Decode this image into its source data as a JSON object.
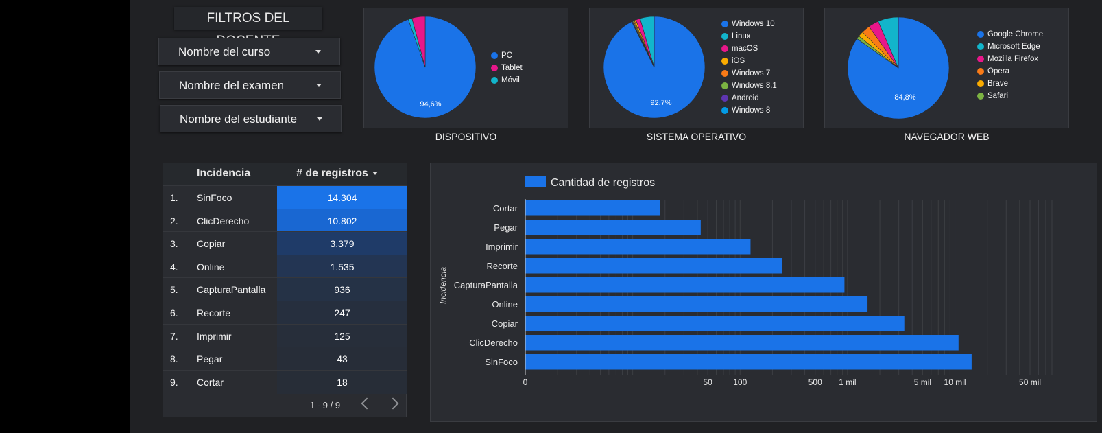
{
  "filters": {
    "title": "FILTROS DEL DOCENTE",
    "course": "Nombre del curso",
    "exam": "Nombre del examen",
    "student": "Nombre del estudiante"
  },
  "pies": [
    {
      "caption": "DISPOSITIVO",
      "center_label": "94,6%",
      "slices": [
        {
          "name": "PC",
          "value": 94.6,
          "color": "#1a73e8"
        },
        {
          "name": "Tablet",
          "value": 4.2,
          "color": "#e8178a"
        },
        {
          "name": "Móvil",
          "value": 1.2,
          "color": "#12b5cb"
        }
      ]
    },
    {
      "caption": "SISTEMA OPERATIVO",
      "center_label": "92,7%",
      "slices": [
        {
          "name": "Windows 10",
          "value": 92.7,
          "color": "#1a73e8"
        },
        {
          "name": "Linux",
          "value": 4.5,
          "color": "#12b5cb"
        },
        {
          "name": "macOS",
          "value": 1.4,
          "color": "#e8178a"
        },
        {
          "name": "iOS",
          "value": 0.5,
          "color": "#f9ab00"
        },
        {
          "name": "Windows 7",
          "value": 0.3,
          "color": "#fa7b17"
        },
        {
          "name": "Windows 8.1",
          "value": 0.3,
          "color": "#7cb342"
        },
        {
          "name": "Android",
          "value": 0.2,
          "color": "#5e35b1"
        },
        {
          "name": "Windows 8",
          "value": 0.1,
          "color": "#039be5"
        }
      ]
    },
    {
      "caption": "NAVEGADOR WEB",
      "center_label": "84,8%",
      "slices": [
        {
          "name": "Google Chrome",
          "value": 84.8,
          "color": "#1a73e8"
        },
        {
          "name": "Microsoft Edge",
          "value": 6.5,
          "color": "#12b5cb"
        },
        {
          "name": "Mozilla Firefox",
          "value": 3.3,
          "color": "#e8178a"
        },
        {
          "name": "Opera",
          "value": 2.7,
          "color": "#fa7b17"
        },
        {
          "name": "Brave",
          "value": 1.7,
          "color": "#f9ab00"
        },
        {
          "name": "Safari",
          "value": 1.0,
          "color": "#7cb342"
        }
      ]
    }
  ],
  "table": {
    "col_incidencia": "Incidencia",
    "col_registros": "# de registros",
    "rows": [
      {
        "n": "1.",
        "name": "SinFoco",
        "value": "14.304"
      },
      {
        "n": "2.",
        "name": "ClicDerecho",
        "value": "10.802"
      },
      {
        "n": "3.",
        "name": "Copiar",
        "value": "3.379"
      },
      {
        "n": "4.",
        "name": "Online",
        "value": "1.535"
      },
      {
        "n": "5.",
        "name": "CapturaPantalla",
        "value": "936"
      },
      {
        "n": "6.",
        "name": "Recorte",
        "value": "247"
      },
      {
        "n": "7.",
        "name": "Imprimir",
        "value": "125"
      },
      {
        "n": "8.",
        "name": "Pegar",
        "value": "43"
      },
      {
        "n": "9.",
        "name": "Cortar",
        "value": "18"
      }
    ],
    "pager": "1 - 9 / 9"
  },
  "chart_data": {
    "type": "bar",
    "orientation": "horizontal",
    "scale": "log",
    "legend": "Cantidad de registros",
    "ylabel": "Incidencia",
    "categories": [
      "Cortar",
      "Pegar",
      "Imprimir",
      "Recorte",
      "CapturaPantalla",
      "Online",
      "Copiar",
      "ClicDerecho",
      "SinFoco"
    ],
    "values": [
      18,
      43,
      125,
      247,
      936,
      1535,
      3379,
      10802,
      14304
    ],
    "xticks": [
      {
        "value": 1,
        "label": "0"
      },
      {
        "value": 50,
        "label": "50"
      },
      {
        "value": 100,
        "label": "100"
      },
      {
        "value": 500,
        "label": "500"
      },
      {
        "value": 1000,
        "label": "1 mil"
      },
      {
        "value": 5000,
        "label": "5 mil"
      },
      {
        "value": 10000,
        "label": "10 mil"
      },
      {
        "value": 50000,
        "label": "50 mil"
      }
    ],
    "xlim": [
      1,
      80000
    ],
    "bar_color": "#1a73e8"
  }
}
